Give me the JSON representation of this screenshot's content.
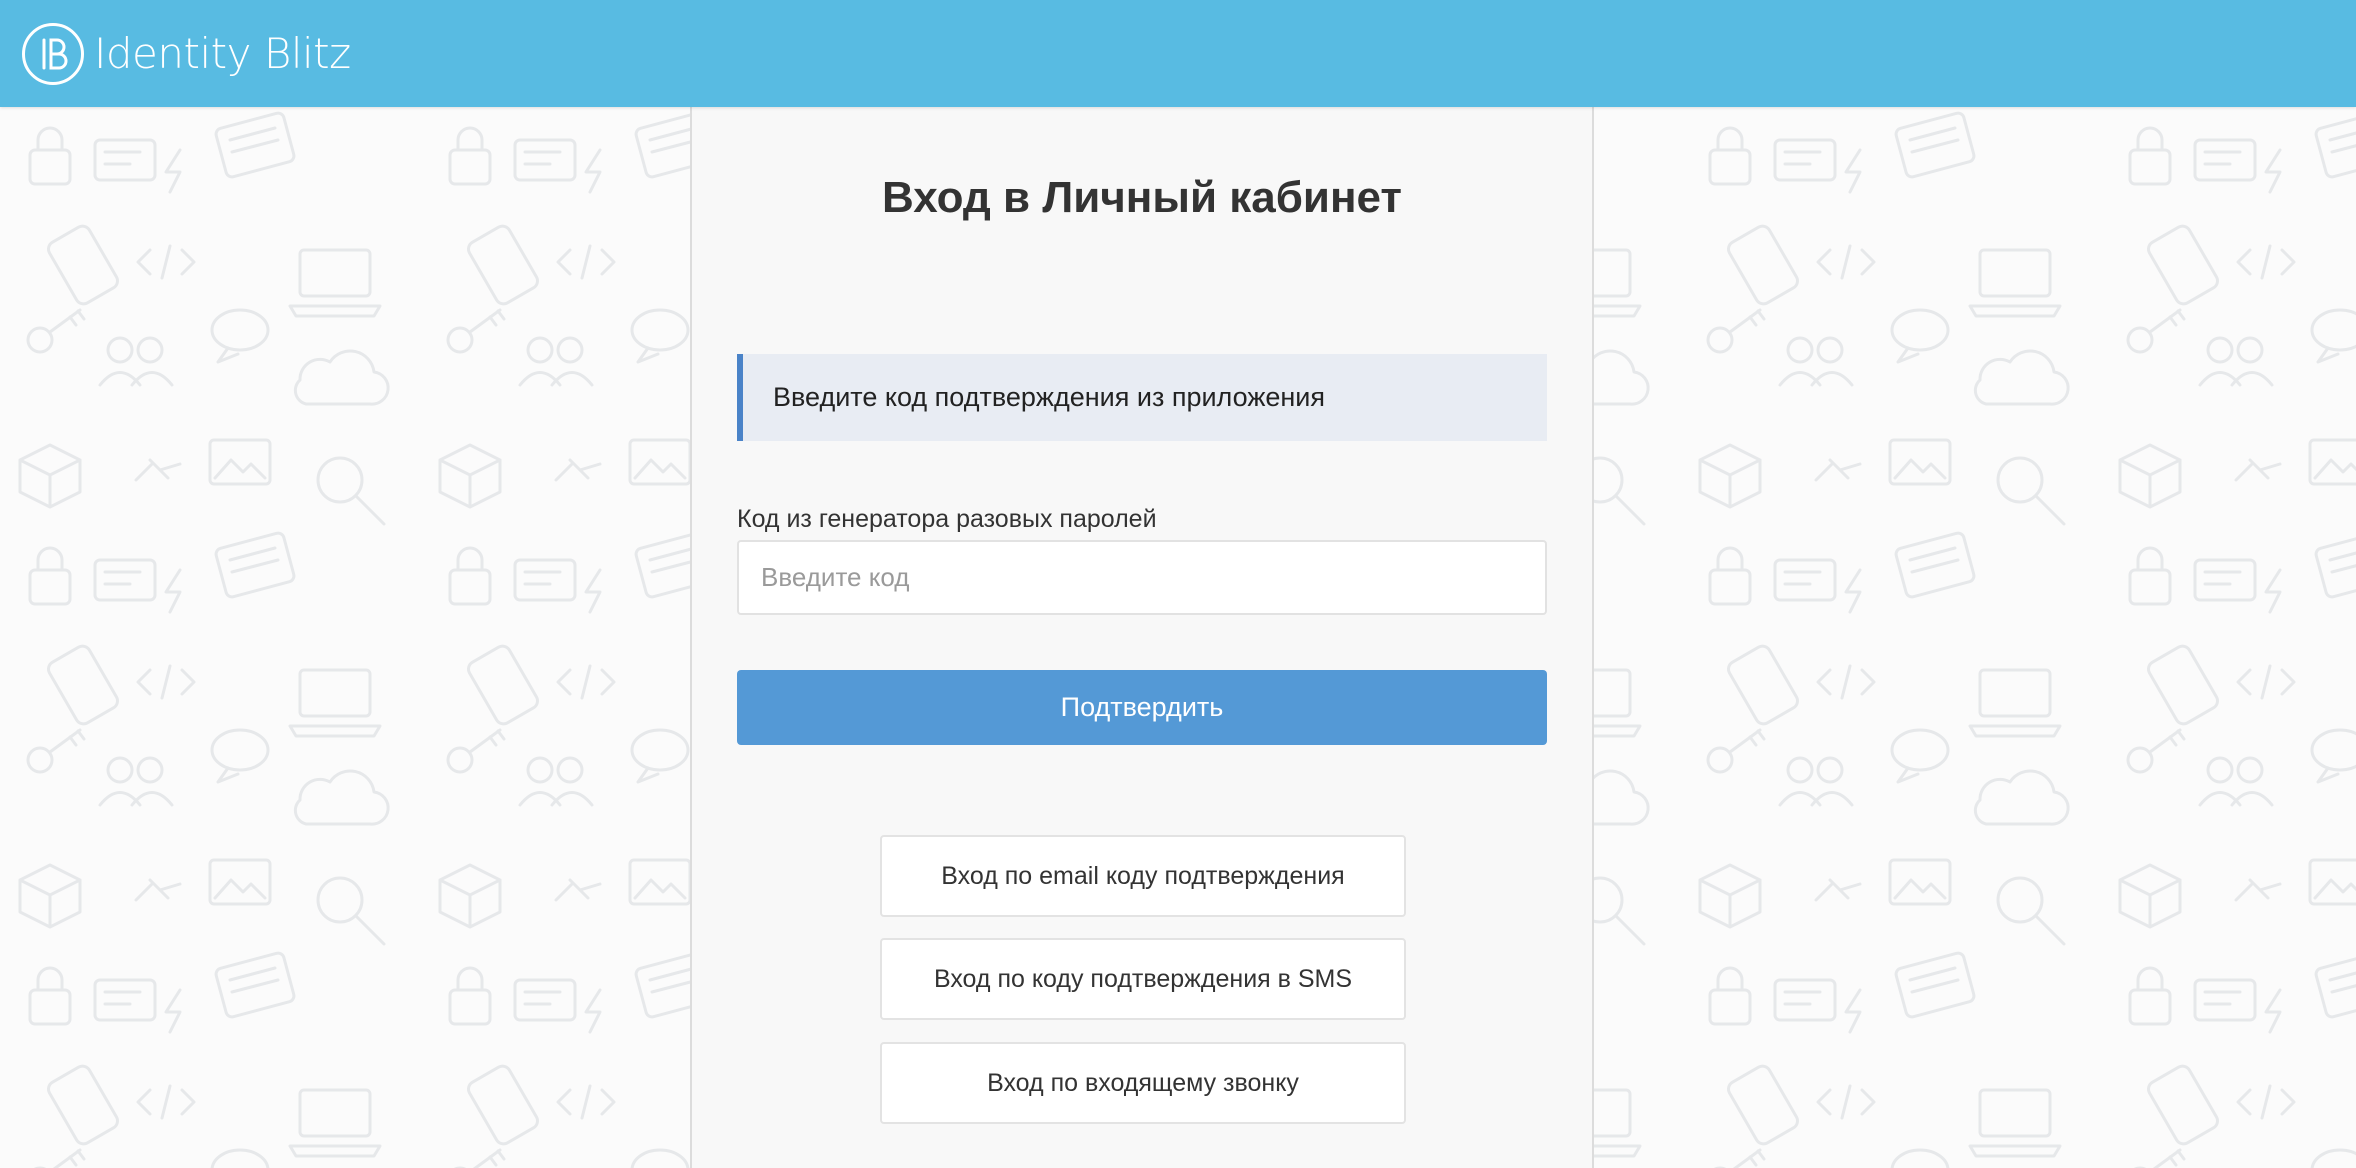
{
  "header": {
    "logo_text": "Identity Blitz",
    "logo_icon": "ib-logo-icon",
    "background_color": "#58bbe2"
  },
  "login": {
    "title_prefix": "Вход в",
    "title_strong": "Личный кабинет",
    "alert_text": "Введите код подтверждения из приложения",
    "field_label": "Код из генератора разовых паролей",
    "input_placeholder": "Введите код",
    "input_value": "",
    "confirm_label": "Подтвердить"
  },
  "alternatives": [
    {
      "label": "Вход по email коду подтверждения"
    },
    {
      "label": "Вход по коду подтверждения в SMS"
    },
    {
      "label": "Вход по входящему звонку"
    }
  ],
  "colors": {
    "accent": "#5499d6",
    "alert_border": "#4a83c8",
    "alert_bg": "#e8ecf3"
  }
}
